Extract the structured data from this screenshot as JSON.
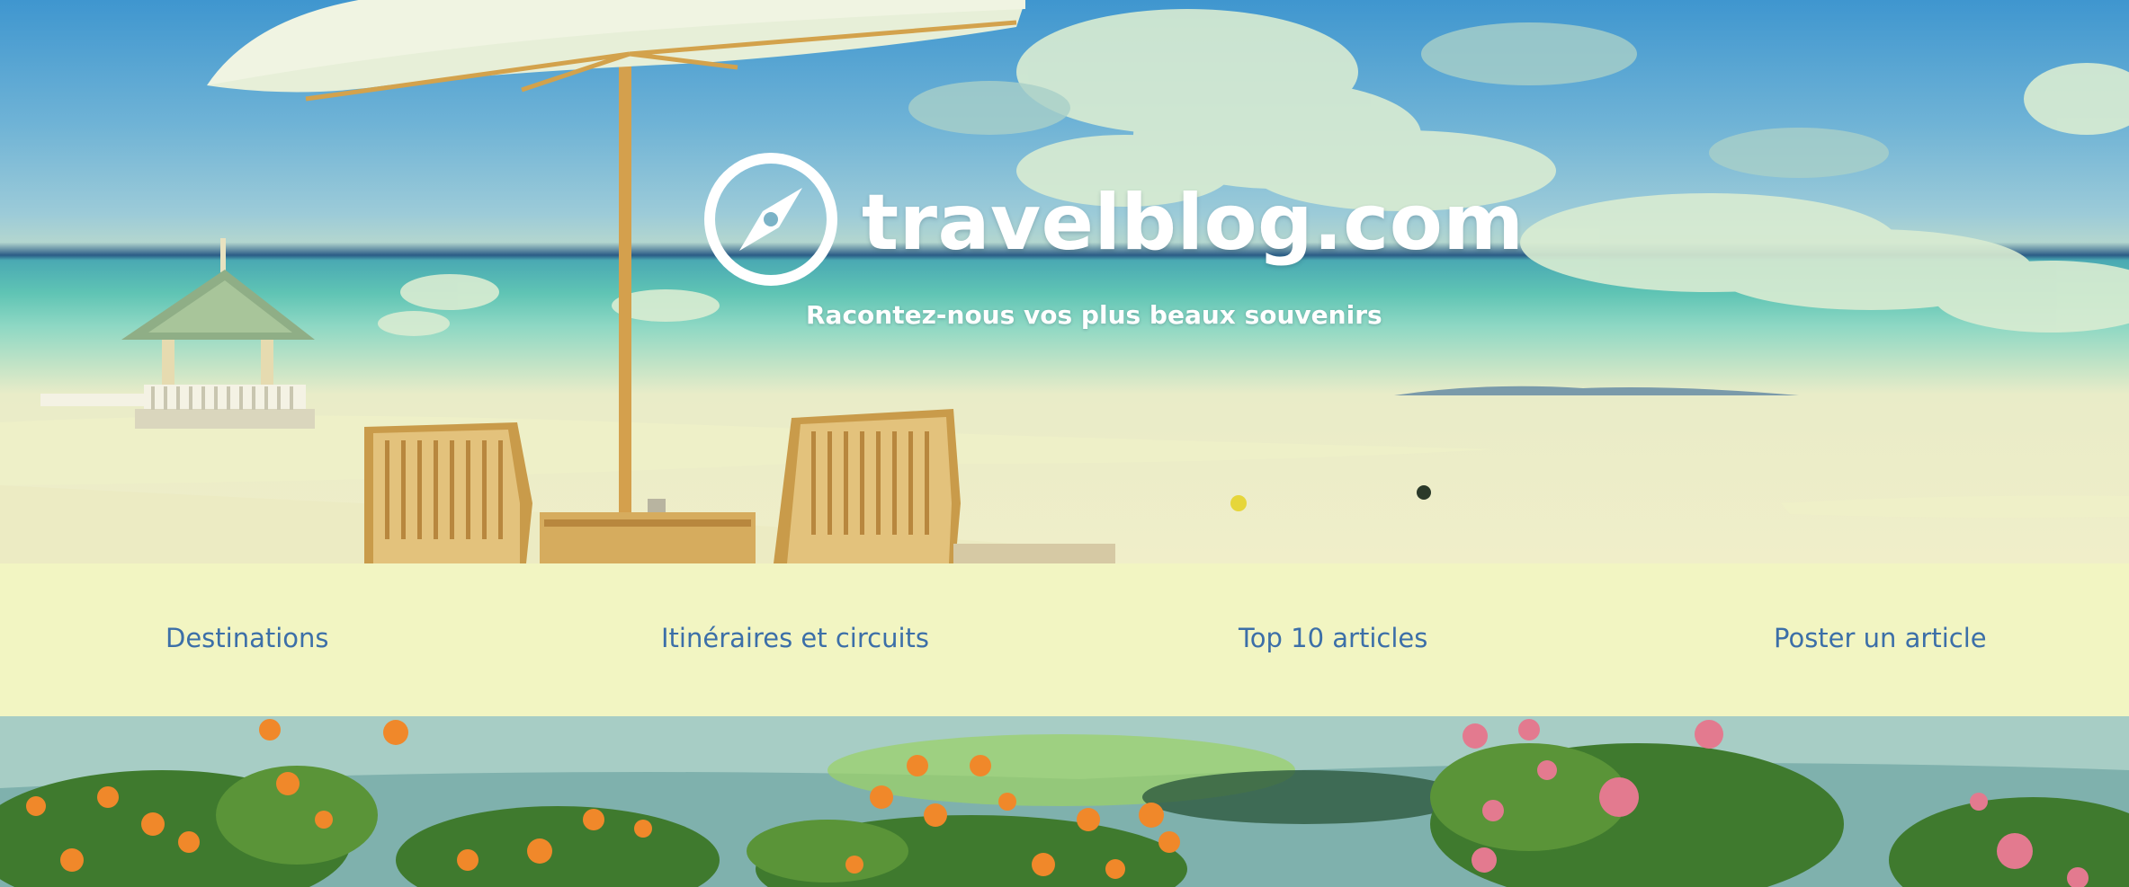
{
  "brand": {
    "name": "travelblog.com",
    "tagline": "Racontez-nous vos plus beaux souvenirs",
    "logo_icon": "compass-icon"
  },
  "nav": {
    "items": [
      {
        "label": "Destinations"
      },
      {
        "label": "Itinéraires et circuits"
      },
      {
        "label": "Top 10 articles"
      },
      {
        "label": "Poster un article"
      }
    ]
  },
  "colors": {
    "nav_background": "#f2f5c2",
    "nav_text": "#3c6fa8",
    "brand_text": "#ffffff"
  }
}
